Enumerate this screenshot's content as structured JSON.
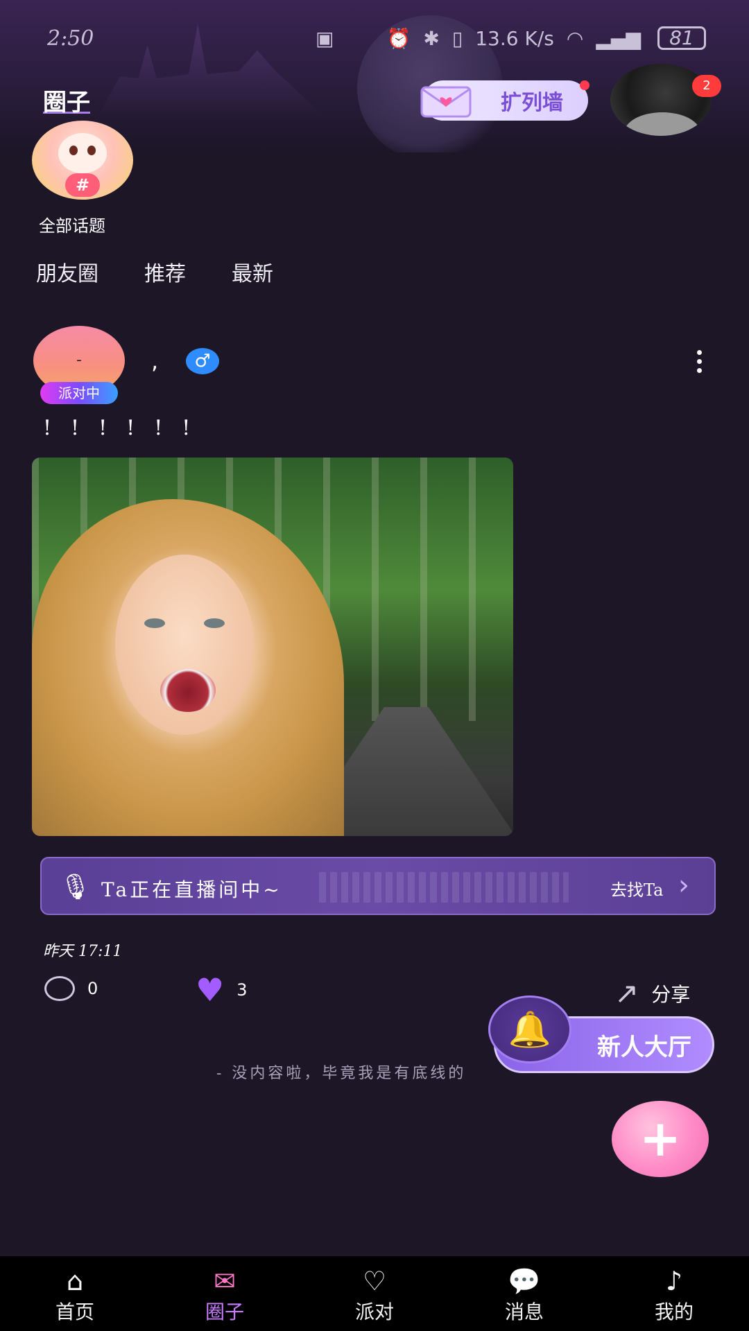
{
  "status_bar": {
    "time": "2:50",
    "net_speed": "13.6 K/s",
    "battery": "81"
  },
  "header": {
    "title": "圈子",
    "wall_button": "扩列墙",
    "notification_count": "2"
  },
  "topics": {
    "badge": "#",
    "label": "全部话题"
  },
  "tabs": [
    "朋友圈",
    "推荐",
    "最新"
  ],
  "post": {
    "avatar_text": "-",
    "party_tag": "派对中",
    "name": ",",
    "gender_symbol": "♂",
    "text": "!!!!!!",
    "live_banner": {
      "text": "Ta正在直播间中~",
      "action": "去找Ta"
    },
    "time": "昨天 17:11",
    "comments": "0",
    "likes": "3",
    "share_label": "分享"
  },
  "newcomer_button": "新人大厅",
  "end_text": "- 没内容啦，毕竟我是有底线的",
  "fab_label": "+",
  "nav": {
    "items": [
      {
        "label": "首页",
        "icon": "home-icon"
      },
      {
        "label": "圈子",
        "icon": "circle-icon"
      },
      {
        "label": "派对",
        "icon": "party-icon"
      },
      {
        "label": "消息",
        "icon": "message-icon"
      },
      {
        "label": "我的",
        "icon": "music-note-icon"
      }
    ]
  },
  "colors": {
    "background": "#1c1627",
    "accent": "#8a64e8",
    "active_nav": "#c87cff"
  }
}
